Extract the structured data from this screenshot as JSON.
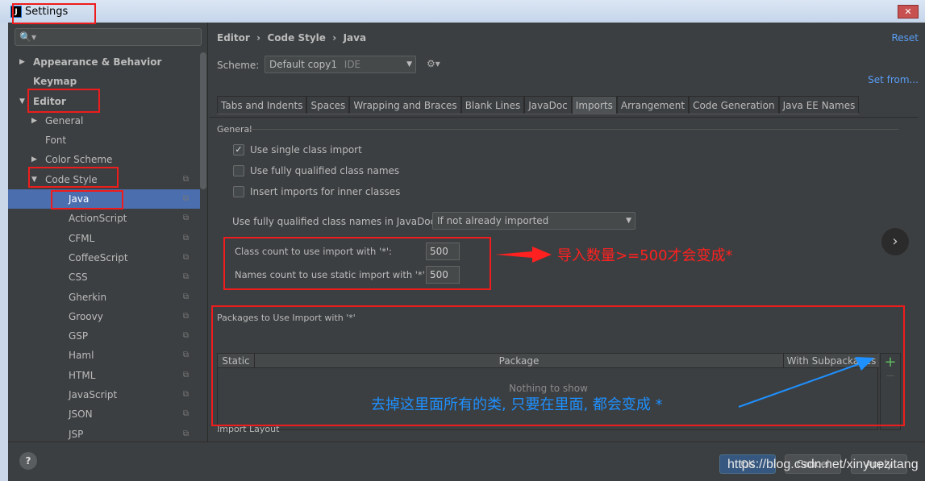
{
  "window": {
    "title": "Settings",
    "close": "✕"
  },
  "sidebar": {
    "search_icon": "🔍▾",
    "items": [
      {
        "label": "Appearance & Behavior",
        "level": 0,
        "arrow": "▶",
        "bold": true
      },
      {
        "label": "Keymap",
        "level": 0,
        "arrow": "",
        "bold": true
      },
      {
        "label": "Editor",
        "level": 0,
        "arrow": "▼",
        "bold": true
      },
      {
        "label": "General",
        "level": 1,
        "arrow": "▶"
      },
      {
        "label": "Font",
        "level": 1,
        "arrow": ""
      },
      {
        "label": "Color Scheme",
        "level": 1,
        "arrow": "▶"
      },
      {
        "label": "Code Style",
        "level": 1,
        "arrow": "▼",
        "copy": true
      },
      {
        "label": "Java",
        "level": 2,
        "selected": true,
        "copy": true
      },
      {
        "label": "ActionScript",
        "level": 2,
        "copy": true
      },
      {
        "label": "CFML",
        "level": 2,
        "copy": true
      },
      {
        "label": "CoffeeScript",
        "level": 2,
        "copy": true
      },
      {
        "label": "CSS",
        "level": 2,
        "copy": true
      },
      {
        "label": "Gherkin",
        "level": 2,
        "copy": true
      },
      {
        "label": "Groovy",
        "level": 2,
        "copy": true
      },
      {
        "label": "GSP",
        "level": 2,
        "copy": true
      },
      {
        "label": "Haml",
        "level": 2,
        "copy": true
      },
      {
        "label": "HTML",
        "level": 2,
        "copy": true
      },
      {
        "label": "JavaScript",
        "level": 2,
        "copy": true
      },
      {
        "label": "JSON",
        "level": 2,
        "copy": true
      },
      {
        "label": "JSP",
        "level": 2,
        "copy": true
      }
    ]
  },
  "header": {
    "breadcrumb": [
      "Editor",
      "Code Style",
      "Java"
    ],
    "sep": "›",
    "reset": "Reset",
    "scheme_label": "Scheme:",
    "scheme_value": "Default copy1",
    "scheme_tag": "IDE",
    "gear": "⚙▾",
    "set_from": "Set from..."
  },
  "tabs": [
    {
      "label": "Tabs and Indents"
    },
    {
      "label": "Spaces"
    },
    {
      "label": "Wrapping and Braces"
    },
    {
      "label": "Blank Lines"
    },
    {
      "label": "JavaDoc"
    },
    {
      "label": "Imports",
      "active": true
    },
    {
      "label": "Arrangement"
    },
    {
      "label": "Code Generation"
    },
    {
      "label": "Java EE Names"
    }
  ],
  "general": {
    "title": "General",
    "options": [
      {
        "label": "Use single class import",
        "checked": true
      },
      {
        "label": "Use fully qualified class names",
        "checked": false
      },
      {
        "label": "Insert imports for inner classes",
        "checked": false
      }
    ],
    "javadoc_label": "Use fully qualified class names in JavaDoc:",
    "javadoc_value": "If not already imported",
    "class_count_label": "Class count to use import with '*':",
    "class_count": "500",
    "names_count_label": "Names count to use static import with '*':",
    "names_count": "500"
  },
  "packages": {
    "title": "Packages to Use Import with '*'",
    "columns": [
      "Static",
      "Package",
      "With Subpackages"
    ],
    "empty": "Nothing to show",
    "add": "+",
    "remove": "—"
  },
  "import_layout": "Import Layout",
  "footer": {
    "ok": "OK",
    "cancel": "Cancel",
    "apply": "Apply",
    "help": "?"
  },
  "annotations": {
    "count_note": "导入数量>=500才会变成*",
    "packages_note": "去掉这里面所有的类, 只要在里面, 都会变成 *"
  },
  "watermark": "https://blog.csdn.net/xinyuezitang",
  "colors": {
    "highlight": "#ee1c1c",
    "note_red": "#ff2020",
    "note_blue": "#1e90ff",
    "selection": "#4b6eaf"
  }
}
